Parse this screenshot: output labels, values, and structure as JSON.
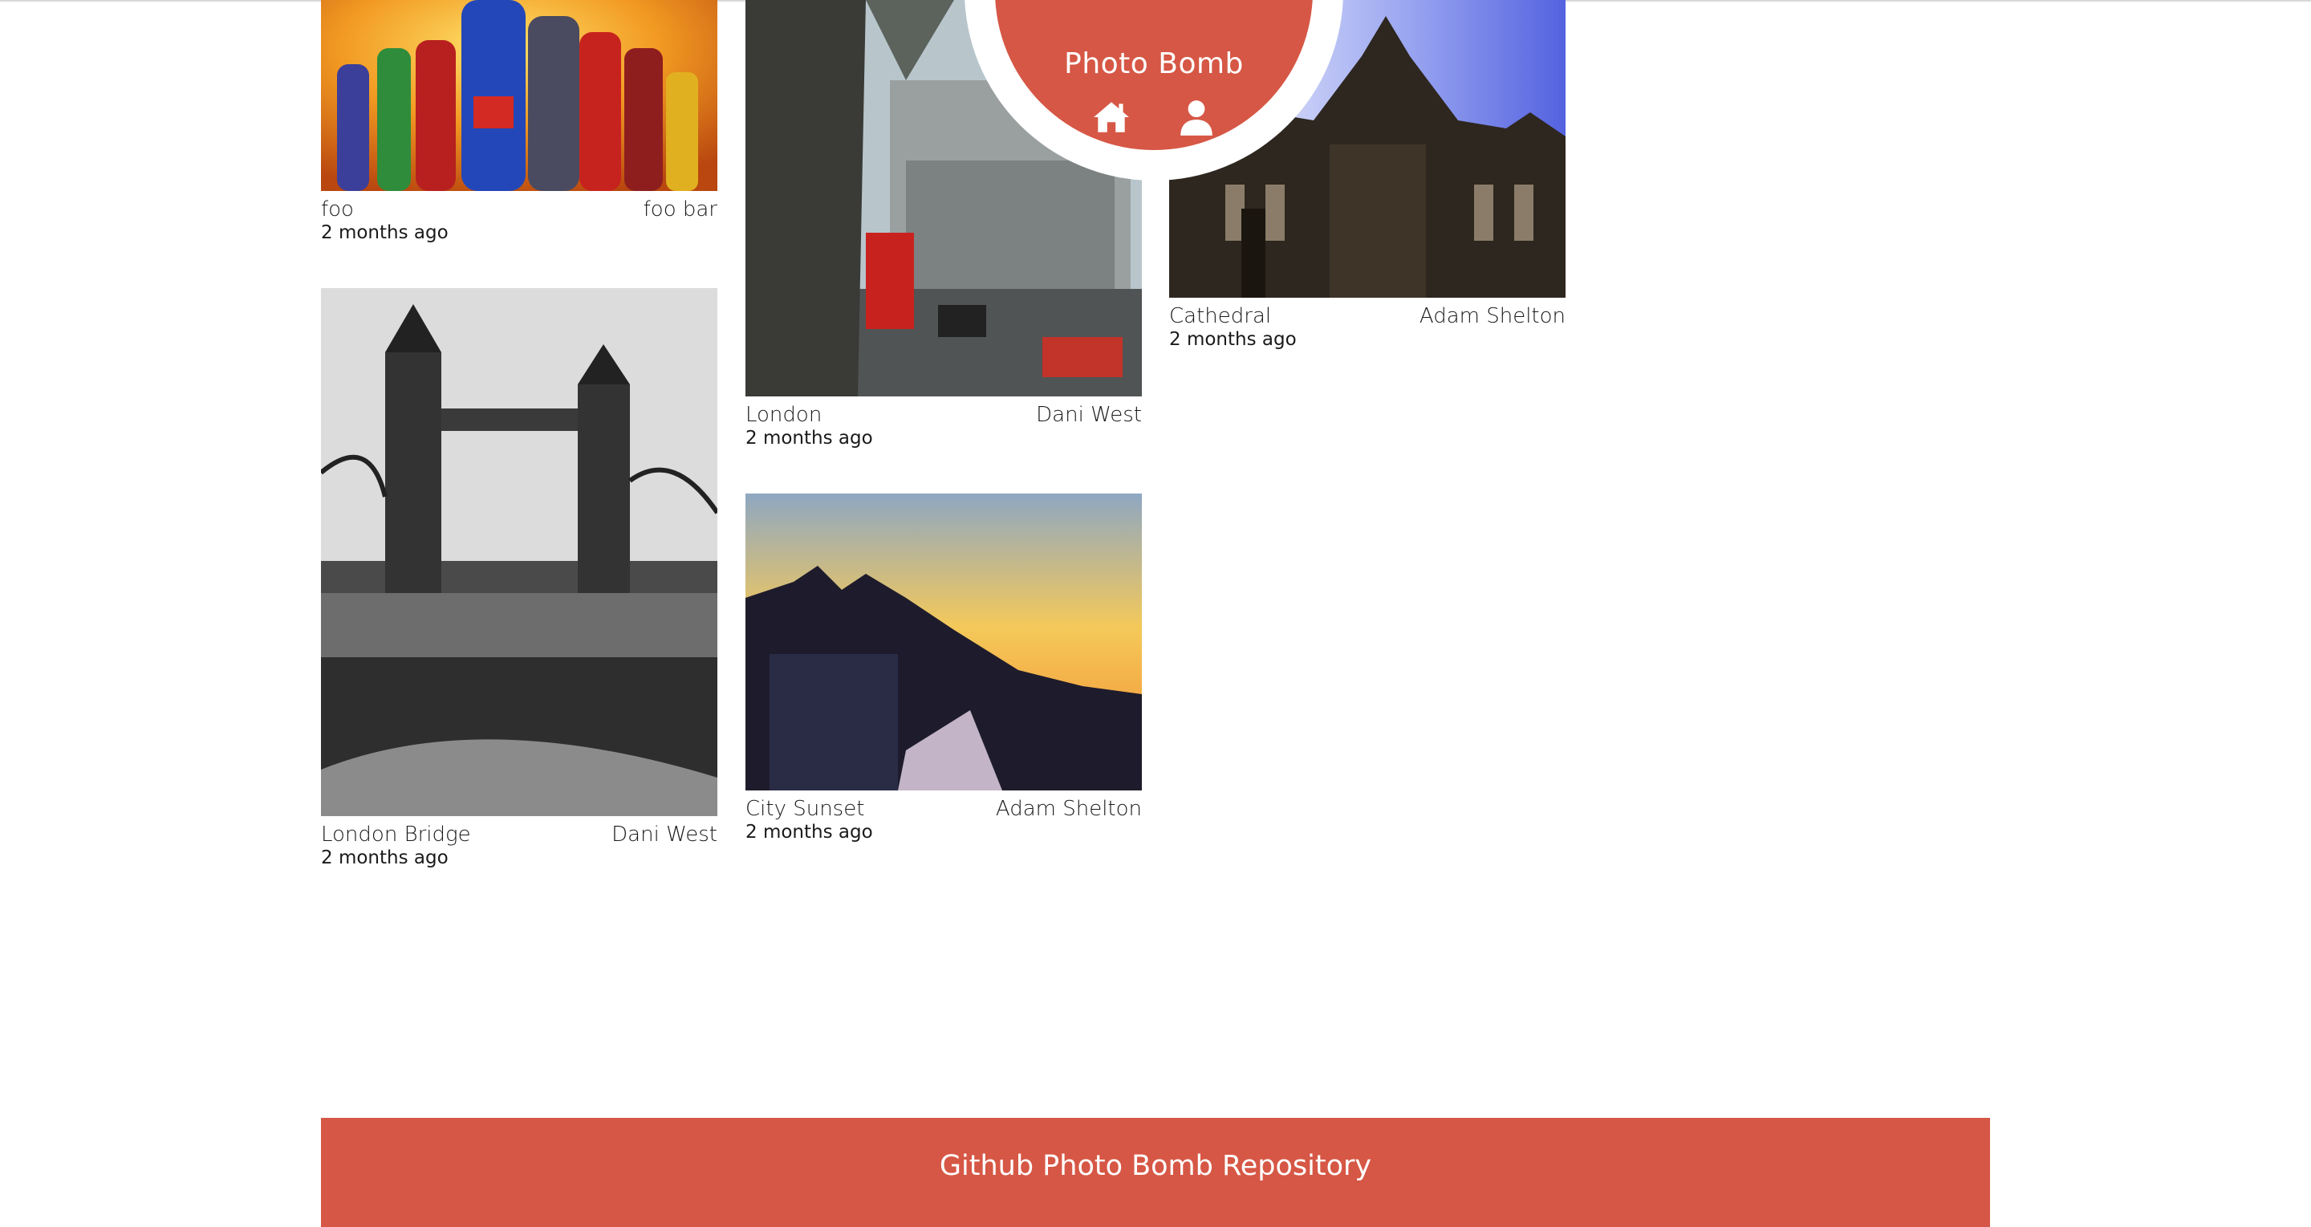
{
  "header": {
    "brand": "Photo Bomb",
    "home_icon": "home-icon",
    "user_icon": "user-icon",
    "color": "#d65745"
  },
  "photos": [
    {
      "title": "foo",
      "author": "foo bar",
      "time": "2 months ago"
    },
    {
      "title": "London Bridge",
      "author": "Dani West",
      "time": "2 months ago"
    },
    {
      "title": "London",
      "author": "Dani West",
      "time": "2 months ago"
    },
    {
      "title": "City Sunset",
      "author": "Adam Shelton",
      "time": "2 months ago"
    },
    {
      "title": "Cathedral",
      "author": "Adam Shelton",
      "time": "2 months ago"
    }
  ],
  "footer": {
    "link_label": "Github Photo Bomb Repository"
  }
}
